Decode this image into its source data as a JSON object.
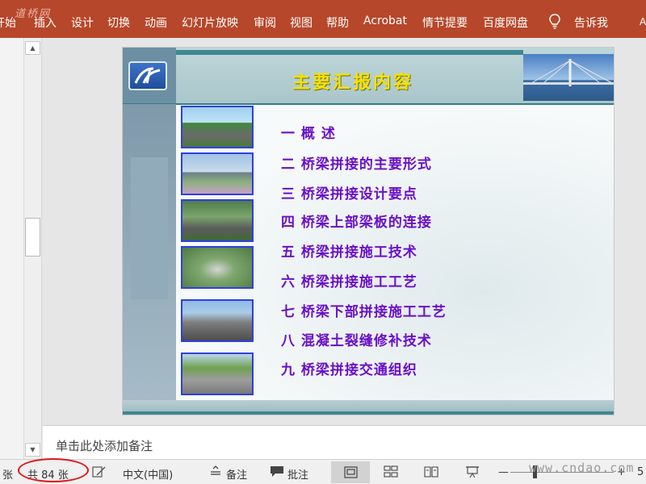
{
  "ribbon": {
    "watermark": "道桥网",
    "tabs": [
      "开始",
      "插入",
      "设计",
      "切换",
      "动画",
      "幻灯片放映",
      "审阅",
      "视图",
      "帮助",
      "Acrobat",
      "情节提要",
      "百度网盘",
      "告诉我"
    ],
    "edge_text": "A"
  },
  "slide": {
    "title": "主要汇报内容",
    "items": [
      "一  概  述",
      "二  桥梁拼接的主要形式",
      "三  桥梁拼接设计要点",
      "四  桥梁上部梁板的连接",
      "五  桥梁拼接施工技术",
      "六  桥梁拼接施工工艺",
      "七  桥梁下部拼接施工工艺",
      "八  混凝土裂缝修补技术",
      "九  桥梁拼接交通组织"
    ]
  },
  "notes": {
    "placeholder": "单击此处添加备注"
  },
  "status": {
    "slide_prefix": "张",
    "slide_count": "共 84 张",
    "language": "中文(中国)",
    "notes_label": "备注",
    "comments_label": "批注",
    "zoom_minus": "—",
    "zoom_plus": "+",
    "zoom_value": "5",
    "watermark": "www.cndao.com"
  },
  "colors": {
    "ribbon": "#b7472a",
    "menu_text": "#6a10c8",
    "title_text": "#f5e100",
    "highlight_circle": "#e0141a"
  }
}
